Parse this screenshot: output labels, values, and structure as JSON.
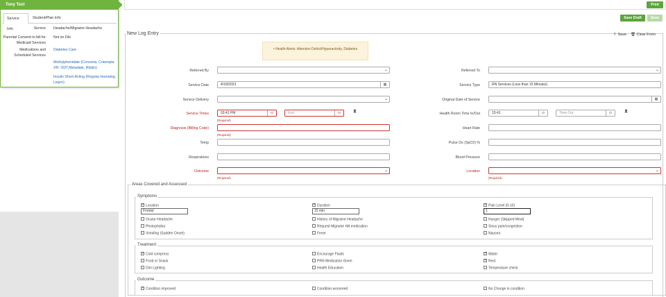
{
  "student": {
    "name": "Tony Test",
    "tabs": [
      "Service Info",
      "Student/Plan Info"
    ],
    "rows": [
      {
        "label": "Service",
        "value": "Headache/Migraine Headache"
      },
      {
        "label": "Parental Consent to bill for Medicaid Services",
        "value": "Not on File"
      },
      {
        "label": "Medications and Scheduled Services",
        "value": "Diabetes Care"
      }
    ],
    "links": [
      "Methylphenidate (Concerta, Cotempla XR- ODT,Metadate, Ritalin)",
      "Insulin Short-Acting (Regular Humalog, Lispro)"
    ]
  },
  "toolbar": {
    "print": "Print",
    "save_draft": "Save Draft",
    "save": "Save"
  },
  "log": {
    "legend": "New Log Entry",
    "save_link": "Save",
    "clear_link": "Clear Form",
    "alert": "Health Alerts: Attention Deficit/Hyperactivity, Diabetes",
    "required": "(Required)",
    "fields": {
      "referred_by": {
        "label": "Referred By",
        "value": ""
      },
      "referred_to": {
        "label": "Referred To",
        "value": ""
      },
      "service_date": {
        "label": "Service Date",
        "value": "4/18/2023"
      },
      "service_type": {
        "label": "Service Type",
        "value": "RN Services (Less than 15 Minutes)"
      },
      "service_delivery": {
        "label": "Service Delivery",
        "value": ""
      },
      "original_date": {
        "label": "Original Date of Service",
        "value": ""
      },
      "service_times": {
        "label": "Service Times",
        "start": "03:41 PM",
        "end_placeholder": "End"
      },
      "health_room_time": {
        "label": "Health Room Time In/Out",
        "in": "15:41",
        "out_placeholder": "Time Out"
      },
      "diagnosis": {
        "label": "Diagnosis (Billing Code)",
        "value": ""
      },
      "heart_rate": {
        "label": "Heart Rate",
        "value": ""
      },
      "temp": {
        "label": "Temp",
        "value": ""
      },
      "pulse_ox": {
        "label": "Pulse Ox (SpO2) %",
        "value": ""
      },
      "respirations": {
        "label": "Respirations",
        "value": ""
      },
      "blood_pressure": {
        "label": "Blood Pressure",
        "value": ""
      },
      "outcome": {
        "label": "Outcome",
        "value": ""
      },
      "location": {
        "label": "Location",
        "value": ""
      }
    }
  },
  "areas": {
    "legend": "Areas Covered and Assessed",
    "symptoms": {
      "legend": "Symptoms",
      "items": [
        {
          "label": "Location",
          "checked": true,
          "input": "Frontal"
        },
        {
          "label": "Duration",
          "checked": true,
          "input": "15 min"
        },
        {
          "label": "Pain Level (0-10)",
          "checked": true,
          "input": "1"
        },
        {
          "label": "Ocular Headache",
          "checked": false
        },
        {
          "label": "History of Migraine Headache",
          "checked": false
        },
        {
          "label": "Hunger (Skipped Meal)",
          "checked": false
        },
        {
          "label": "Photophobia",
          "checked": false
        },
        {
          "label": "Request Migraine HA medication",
          "checked": false
        },
        {
          "label": "Sinus pain/congestion",
          "checked": false
        },
        {
          "label": "Vomiting (Sudden Onset)",
          "checked": false
        },
        {
          "label": "Fever",
          "checked": false
        },
        {
          "label": "Nausea",
          "checked": false
        }
      ]
    },
    "treatment": {
      "legend": "Treatment",
      "items": [
        {
          "label": "Cold compress",
          "checked": true
        },
        {
          "label": "Encourage Fluids",
          "checked": false
        },
        {
          "label": "Water",
          "checked": true
        },
        {
          "label": "Food or Snack",
          "checked": false
        },
        {
          "label": "PRN Medication Given",
          "checked": false
        },
        {
          "label": "Rest",
          "checked": true
        },
        {
          "label": "Dim Lighting",
          "checked": false
        },
        {
          "label": "Health Education",
          "checked": false
        },
        {
          "label": "Temperature check",
          "checked": false
        }
      ]
    },
    "outcome": {
      "legend": "Outcome",
      "items": [
        {
          "label": "Condition improved",
          "checked": true
        },
        {
          "label": "Condition worsened",
          "checked": false
        },
        {
          "label": "No Change in condition",
          "checked": false
        }
      ]
    }
  }
}
